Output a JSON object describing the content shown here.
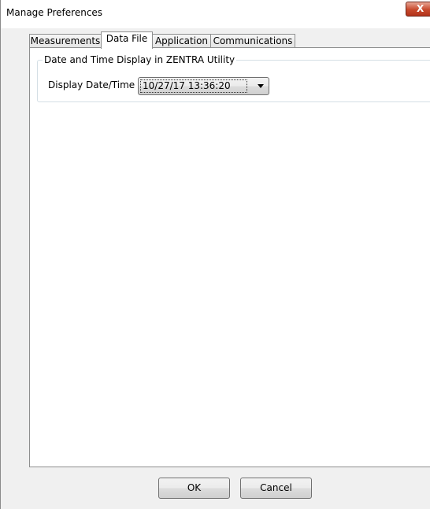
{
  "window": {
    "title": "Manage Preferences",
    "close_glyph": "X"
  },
  "tabs": [
    {
      "label": "Measurements",
      "active": false
    },
    {
      "label": "Data File",
      "active": true
    },
    {
      "label": "Application",
      "active": false
    },
    {
      "label": "Communications",
      "active": false
    }
  ],
  "group": {
    "legend": "Date and Time Display in ZENTRA Utility",
    "field_label": "Display Date/Time",
    "selected_value": "10/27/17 13:36:20"
  },
  "buttons": {
    "ok_label": "OK",
    "cancel_label": "Cancel"
  },
  "colors": {
    "close_button": "#c7492c",
    "panel_background": "#ffffff",
    "dialog_background": "#f0f0f0"
  }
}
